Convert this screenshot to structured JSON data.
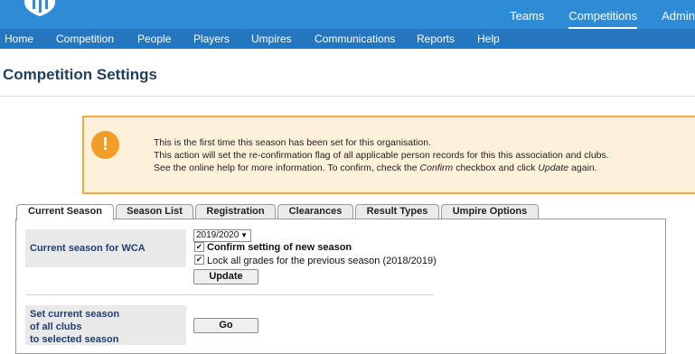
{
  "topnav": {
    "items": [
      "Teams",
      "Competitions",
      "Admin"
    ],
    "active_index": 1
  },
  "mainnav": {
    "items": [
      "Home",
      "Competition",
      "People",
      "Players",
      "Umpires",
      "Communications",
      "Reports",
      "Help"
    ]
  },
  "page": {
    "title": "Competition Settings"
  },
  "alert": {
    "icon": "exclamation-icon",
    "icon_glyph": "!",
    "line1": "This is the first time this season has been set for this organisation.",
    "line2": "This action will set the re-confirmation flag of all applicable person records for this this association and clubs.",
    "line3_a": "See the online help for more information. To confirm, check the ",
    "line3_confirm": "Confirm",
    "line3_b": " checkbox and click ",
    "line3_update": "Update",
    "line3_c": " again."
  },
  "tabs": [
    "Current Season",
    "Season List",
    "Registration",
    "Clearances",
    "Result Types",
    "Umpire Options"
  ],
  "current_season": {
    "label": "Current season for WCA",
    "selected_season": "2019/2020",
    "confirm_label": "Confirm setting of new season",
    "confirm_checked": true,
    "lock_label": "Lock all grades for the previous season (2018/2019)",
    "lock_checked": true,
    "update_button": "Update"
  },
  "clubs_season": {
    "label_line1": "Set current season",
    "label_line2": "of all clubs",
    "label_line3": "to selected season",
    "go_button": "Go"
  },
  "colors": {
    "topbar": "#2e8bd6",
    "navbar": "#2576bf",
    "alert_border": "#f4a93c",
    "alert_bg": "#fdf1d9",
    "title": "#1f3f5f"
  }
}
